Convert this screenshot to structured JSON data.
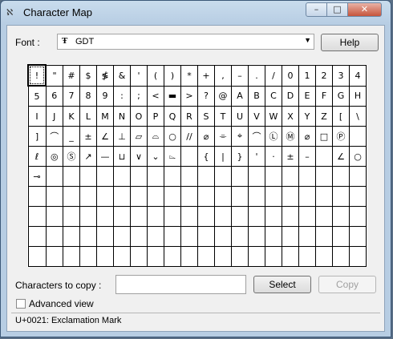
{
  "window": {
    "title": "Character Map",
    "minimize": "–",
    "maximize": "□",
    "close": "✕"
  },
  "font": {
    "label": "Font :",
    "selected": "GDT",
    "font_glyph": "Ŧ",
    "dropdown_arrow": "▼"
  },
  "help_button": "Help",
  "grid": {
    "rows": [
      [
        "!",
        "\"",
        "#",
        "$",
        "≸",
        "&",
        "'",
        "(",
        ")",
        "*",
        "+",
        ",",
        "–",
        ".",
        "/",
        "0",
        "1",
        "2",
        "3",
        "4"
      ],
      [
        "5",
        "6",
        "7",
        "8",
        "9",
        ":",
        ";",
        "<",
        "▬",
        ">",
        "?",
        "@",
        "A",
        "B",
        "C",
        "D",
        "E",
        "F",
        "G",
        "H"
      ],
      [
        "I",
        "J",
        "K",
        "L",
        "M",
        "N",
        "O",
        "P",
        "Q",
        "R",
        "S",
        "T",
        "U",
        "V",
        "W",
        "X",
        "Y",
        "Z",
        "[",
        "\\"
      ],
      [
        "]",
        "⌒",
        "_",
        "±",
        "∠",
        "⊥",
        "▱",
        "⌓",
        "○",
        "//",
        "⌀",
        "⌯",
        "⌖",
        "⌒",
        "Ⓛ",
        "Ⓜ",
        "⌀",
        "□",
        "Ⓟ",
        ""
      ],
      [
        "ℓ",
        "◎",
        "Ⓢ",
        "↗",
        "—",
        "⊔",
        "∨",
        "⌄",
        "⌳",
        "",
        "{",
        "|",
        "}",
        "'",
        "·",
        "±",
        "–",
        "",
        "∠",
        "○"
      ],
      [
        "⊸",
        "",
        "",
        "",
        "",
        "",
        "",
        "",
        "",
        "",
        "",
        "",
        "",
        "",
        "",
        "",
        "",
        "",
        "",
        ""
      ],
      [
        "",
        "",
        "",
        "",
        "",
        "",
        "",
        "",
        "",
        "",
        "",
        "",
        "",
        "",
        "",
        "",
        "",
        "",
        "",
        ""
      ],
      [
        "",
        "",
        "",
        "",
        "",
        "",
        "",
        "",
        "",
        "",
        "",
        "",
        "",
        "",
        "",
        "",
        "",
        "",
        "",
        ""
      ],
      [
        "",
        "",
        "",
        "",
        "",
        "",
        "",
        "",
        "",
        "",
        "",
        "",
        "",
        "",
        "",
        "",
        "",
        "",
        "",
        ""
      ],
      [
        "",
        "",
        "",
        "",
        "",
        "",
        "",
        "",
        "",
        "",
        "",
        "",
        "",
        "",
        "",
        "",
        "",
        "",
        "",
        ""
      ]
    ]
  },
  "copy": {
    "label": "Characters to copy :",
    "value": "",
    "select_button": "Select",
    "copy_button": "Copy"
  },
  "advanced_view": {
    "label": "Advanced view",
    "checked": false
  },
  "status": "U+0021: Exclamation Mark"
}
